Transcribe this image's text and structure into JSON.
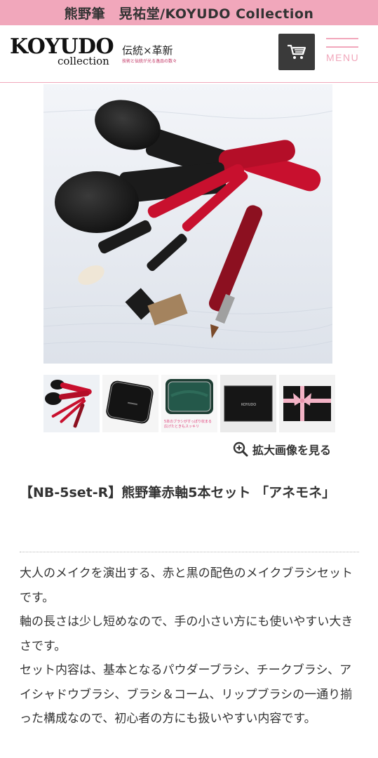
{
  "topbar": {
    "title": "熊野筆　晃祐堂/KOYUDO Collection"
  },
  "header": {
    "logo_main": "KOYUDO",
    "logo_sub": "collection",
    "tagline_main": "伝統×革新",
    "tagline_sub": "技術と伝統が光る逸品の数々",
    "cart_icon": "cart-icon",
    "menu_label": "MENU"
  },
  "hero": {
    "icon": "product-photo"
  },
  "thumbnails": [
    {
      "icon": "brush-set-thumbnail"
    },
    {
      "icon": "black-case-thumbnail"
    },
    {
      "icon": "green-case-open-thumbnail",
      "caption": "5本のブラシがすっぽり収まる 広げたときもスッキリ"
    },
    {
      "icon": "gift-box-thumbnail",
      "box_text": "KOYUDO"
    },
    {
      "icon": "ribbon-box-thumbnail"
    }
  ],
  "zoom": {
    "label": "拡大画像を見る",
    "icon": "zoom-in-icon"
  },
  "product": {
    "title": "【NB-5set-R】熊野筆赤軸5本セット 「アネモネ」",
    "description": [
      "大人のメイクを演出する、赤と黒の配色のメイクブラシセットです。",
      "軸の長さは少し短めなので、手の小さい方にも使いやすい大きさです。",
      "セット内容は、基本となるパウダーブラシ、チークブラシ、アイシャドウブラシ、ブラシ＆コーム、リップブラシの一通り揃った構成なので、初心者の方にも扱いやすい内容です。"
    ]
  },
  "colors": {
    "brand_pink": "#f1a7bb",
    "brush_red": "#c8102e",
    "dark": "#3a3a3a"
  }
}
